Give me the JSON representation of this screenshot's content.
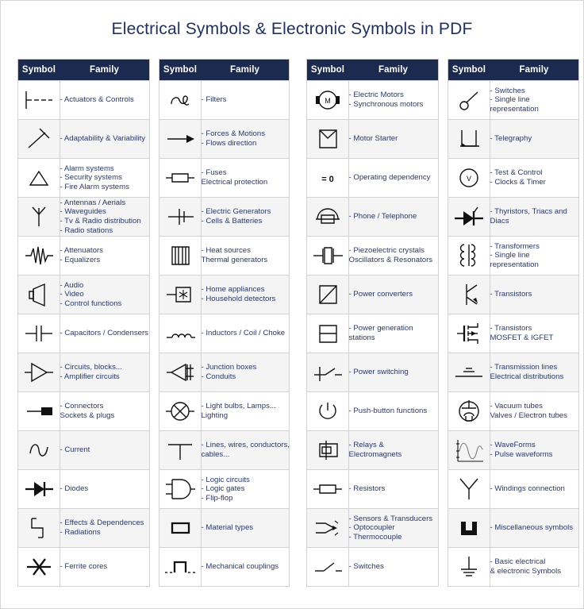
{
  "page": {
    "title": "Electrical Symbols & Electronic Symbols in PDF"
  },
  "headers": {
    "symbol": "Symbol",
    "family": "Family"
  },
  "tables": [
    {
      "id": "table-1",
      "rows": [
        {
          "icon": "actuators-controls-symbol",
          "lines": [
            "- Actuators & Controls"
          ]
        },
        {
          "icon": "adaptability-variability-symbol",
          "lines": [
            "- Adaptability & Variability"
          ]
        },
        {
          "icon": "alarm-systems-symbol",
          "lines": [
            "- Alarm systems",
            "- Security systems",
            "- Fire Alarm systems"
          ]
        },
        {
          "icon": "antenna-symbol",
          "lines": [
            "- Antennas / Aerials",
            "- Waveguides",
            "- Tv & Radio distribution",
            "- Radio stations"
          ]
        },
        {
          "icon": "attenuator-symbol",
          "lines": [
            "- Attenuators",
            "- Equalizers"
          ]
        },
        {
          "icon": "loudspeaker-symbol",
          "lines": [
            "- Audio",
            "- Video",
            "- Control functions"
          ]
        },
        {
          "icon": "capacitor-symbol",
          "lines": [
            "- Capacitors / Condensers"
          ]
        },
        {
          "icon": "amplifier-symbol",
          "lines": [
            "- Circuits, blocks...",
            "- Amplifier circuits"
          ]
        },
        {
          "icon": "connector-plug-symbol",
          "lines": [
            "- Connectors",
            "Sockets & plugs"
          ]
        },
        {
          "icon": "alternating-current-symbol",
          "lines": [
            "- Current"
          ]
        },
        {
          "icon": "diode-symbol",
          "lines": [
            "- Diodes"
          ]
        },
        {
          "icon": "effects-dependences-symbol",
          "lines": [
            "- Effects & Dependences",
            "- Radiations"
          ]
        },
        {
          "icon": "ferrite-core-symbol",
          "lines": [
            "- Ferrite cores"
          ]
        }
      ]
    },
    {
      "id": "table-2",
      "rows": [
        {
          "icon": "filter-symbol",
          "lines": [
            "- Filters"
          ]
        },
        {
          "icon": "arrow-direction-symbol",
          "lines": [
            "- Forces & Motions",
            "- Flows direction"
          ]
        },
        {
          "icon": "fuse-symbol",
          "lines": [
            "- Fuses",
            "Electrical protection"
          ]
        },
        {
          "icon": "battery-cell-symbol",
          "lines": [
            "- Electric Generators",
            "- Cells & Batteries"
          ]
        },
        {
          "icon": "heat-source-symbol",
          "lines": [
            "- Heat sources",
            "Thermal generators"
          ]
        },
        {
          "icon": "home-appliance-symbol",
          "lines": [
            "- Home appliances",
            "- Household detectors"
          ]
        },
        {
          "icon": "inductor-coil-symbol",
          "lines": [
            "- Inductors / Coil / Choke"
          ]
        },
        {
          "icon": "junction-box-symbol",
          "lines": [
            "- Junction boxes",
            "- Conduits"
          ]
        },
        {
          "icon": "lamp-symbol",
          "lines": [
            "- Light bulbs, Lamps...",
            "Lighting"
          ]
        },
        {
          "icon": "wire-junction-symbol",
          "lines": [
            "- Lines, wires, conductors,",
            "cables..."
          ]
        },
        {
          "icon": "logic-gate-symbol",
          "lines": [
            "- Logic circuits",
            "- Logic gates",
            "- Flip-flop"
          ]
        },
        {
          "icon": "material-type-symbol",
          "lines": [
            "- Material types"
          ]
        },
        {
          "icon": "mechanical-coupling-symbol",
          "lines": [
            "- Mechanical couplings"
          ]
        }
      ]
    },
    {
      "id": "table-3",
      "rows": [
        {
          "icon": "electric-motor-symbol",
          "lines": [
            "- Electric Motors",
            "- Synchronous motors"
          ]
        },
        {
          "icon": "motor-starter-symbol",
          "lines": [
            "- Motor Starter"
          ]
        },
        {
          "icon": "operating-dependency-symbol",
          "lines": [
            "- Operating dependency"
          ]
        },
        {
          "icon": "telephone-symbol",
          "lines": [
            "- Phone / Telephone"
          ]
        },
        {
          "icon": "piezoelectric-crystal-symbol",
          "lines": [
            "- Piezoelectric crystals",
            "Oscillators & Resonators"
          ]
        },
        {
          "icon": "power-converter-symbol",
          "lines": [
            "- Power converters"
          ]
        },
        {
          "icon": "power-generation-symbol",
          "lines": [
            "- Power generation",
            "stations"
          ]
        },
        {
          "icon": "power-switching-symbol",
          "lines": [
            "- Power switching"
          ]
        },
        {
          "icon": "push-button-power-symbol",
          "lines": [
            "- Push-button functions"
          ]
        },
        {
          "icon": "relay-symbol",
          "lines": [
            "- Relays &",
            "Electromagnets"
          ]
        },
        {
          "icon": "resistor-symbol",
          "lines": [
            "- Resistors"
          ]
        },
        {
          "icon": "sensor-transducer-symbol",
          "lines": [
            "- Sensors & Transducers",
            "- Optocoupler",
            "- Thermocouple"
          ]
        },
        {
          "icon": "switch-symbol",
          "lines": [
            "- Switches"
          ]
        }
      ]
    },
    {
      "id": "table-4",
      "rows": [
        {
          "icon": "switch-single-line-symbol",
          "lines": [
            "- Switches",
            "- Single line",
            "representation"
          ]
        },
        {
          "icon": "telegraphy-symbol",
          "lines": [
            "- Telegraphy"
          ]
        },
        {
          "icon": "voltmeter-symbol",
          "lines": [
            "- Test & Control",
            "- Clocks & Timer"
          ]
        },
        {
          "icon": "thyristor-symbol",
          "lines": [
            "- Thyristors, Triacs and",
            "Diacs"
          ]
        },
        {
          "icon": "transformer-symbol",
          "lines": [
            "- Transformers",
            "- Single line",
            "representation"
          ]
        },
        {
          "icon": "transistor-symbol",
          "lines": [
            "- Transistors"
          ]
        },
        {
          "icon": "mosfet-symbol",
          "lines": [
            "- Transistors",
            "MOSFET & IGFET"
          ]
        },
        {
          "icon": "transmission-line-symbol",
          "lines": [
            "- Transmission lines",
            "Electrical distributions"
          ]
        },
        {
          "icon": "vacuum-tube-symbol",
          "lines": [
            "- Vacuum tubes",
            "Valves / Electron tubes"
          ]
        },
        {
          "icon": "waveform-symbol",
          "lines": [
            "- WaveForms",
            "- Pulse waveforms"
          ]
        },
        {
          "icon": "windings-connection-symbol",
          "lines": [
            "- Windings connection"
          ]
        },
        {
          "icon": "miscellaneous-symbol",
          "lines": [
            "- Miscellaneous symbols"
          ]
        },
        {
          "icon": "earth-ground-symbol",
          "lines": [
            "- Basic electrical",
            "& electronic Symbols"
          ]
        }
      ]
    }
  ],
  "colors": {
    "header_background": "#1d2a4f",
    "header_text": "#ffffff",
    "title_text": "#22315c",
    "family_text": "#2a3866",
    "row_alt_background": "#f4f4f4",
    "symbol_stroke": "#111111",
    "table_border": "#d3d3d3"
  }
}
